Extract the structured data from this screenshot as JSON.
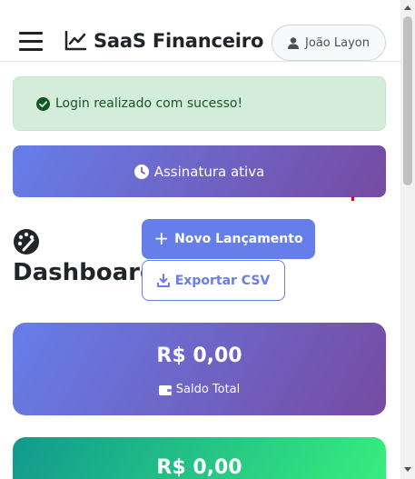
{
  "navbar": {
    "brand": "SaaS Financeiro",
    "user_name": "João Layon",
    "menu_icon": "hamburger-menu-icon",
    "brand_icon": "line-chart-icon",
    "user_icon": "user-icon"
  },
  "alert": {
    "message": "Login realizado com sucesso!",
    "icon": "check-circle-icon",
    "color": "#155724",
    "background": "#d4edda"
  },
  "subscription": {
    "label": "Assinatura ativa",
    "icon": "clock-icon",
    "gradient": [
      "#667eea",
      "#764ba2"
    ]
  },
  "dashboard": {
    "title": "Dashboard",
    "icon": "palette-icon",
    "new_entry_label": "Novo Lançamento",
    "export_label": "Exportar CSV",
    "accent": "#667eea"
  },
  "cards": [
    {
      "value": "R$ 0,00",
      "label": "Saldo Total",
      "icon": "wallet-icon",
      "gradient": [
        "#667eea",
        "#764ba2"
      ]
    },
    {
      "value": "R$ 0,00",
      "gradient": [
        "#11998e",
        "#38ef7d"
      ]
    }
  ]
}
